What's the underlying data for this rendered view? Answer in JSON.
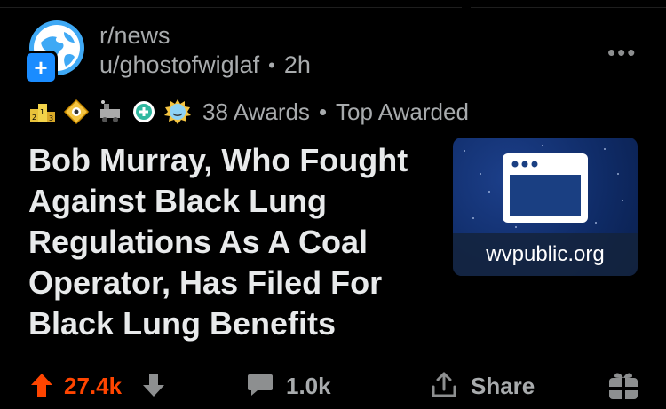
{
  "post": {
    "subreddit": "r/news",
    "author": "u/ghostofwiglaf",
    "separator": "•",
    "age": "2h",
    "more_icon": "more-dots",
    "awards_count": "38 Awards",
    "awards_label": "Top Awarded",
    "title": "Bob Murray, Who Fought Against Black Lung Regulations As A Coal Operator, Has Filed For Black Lung Benefits",
    "link_domain": "wvpublic.org"
  },
  "actions": {
    "score": "27.4k",
    "comments": "1.0k",
    "share_label": "Share"
  },
  "colors": {
    "upvote": "#ff4500",
    "accent_blue": "#1a8cff",
    "text_muted": "#a8abad"
  }
}
